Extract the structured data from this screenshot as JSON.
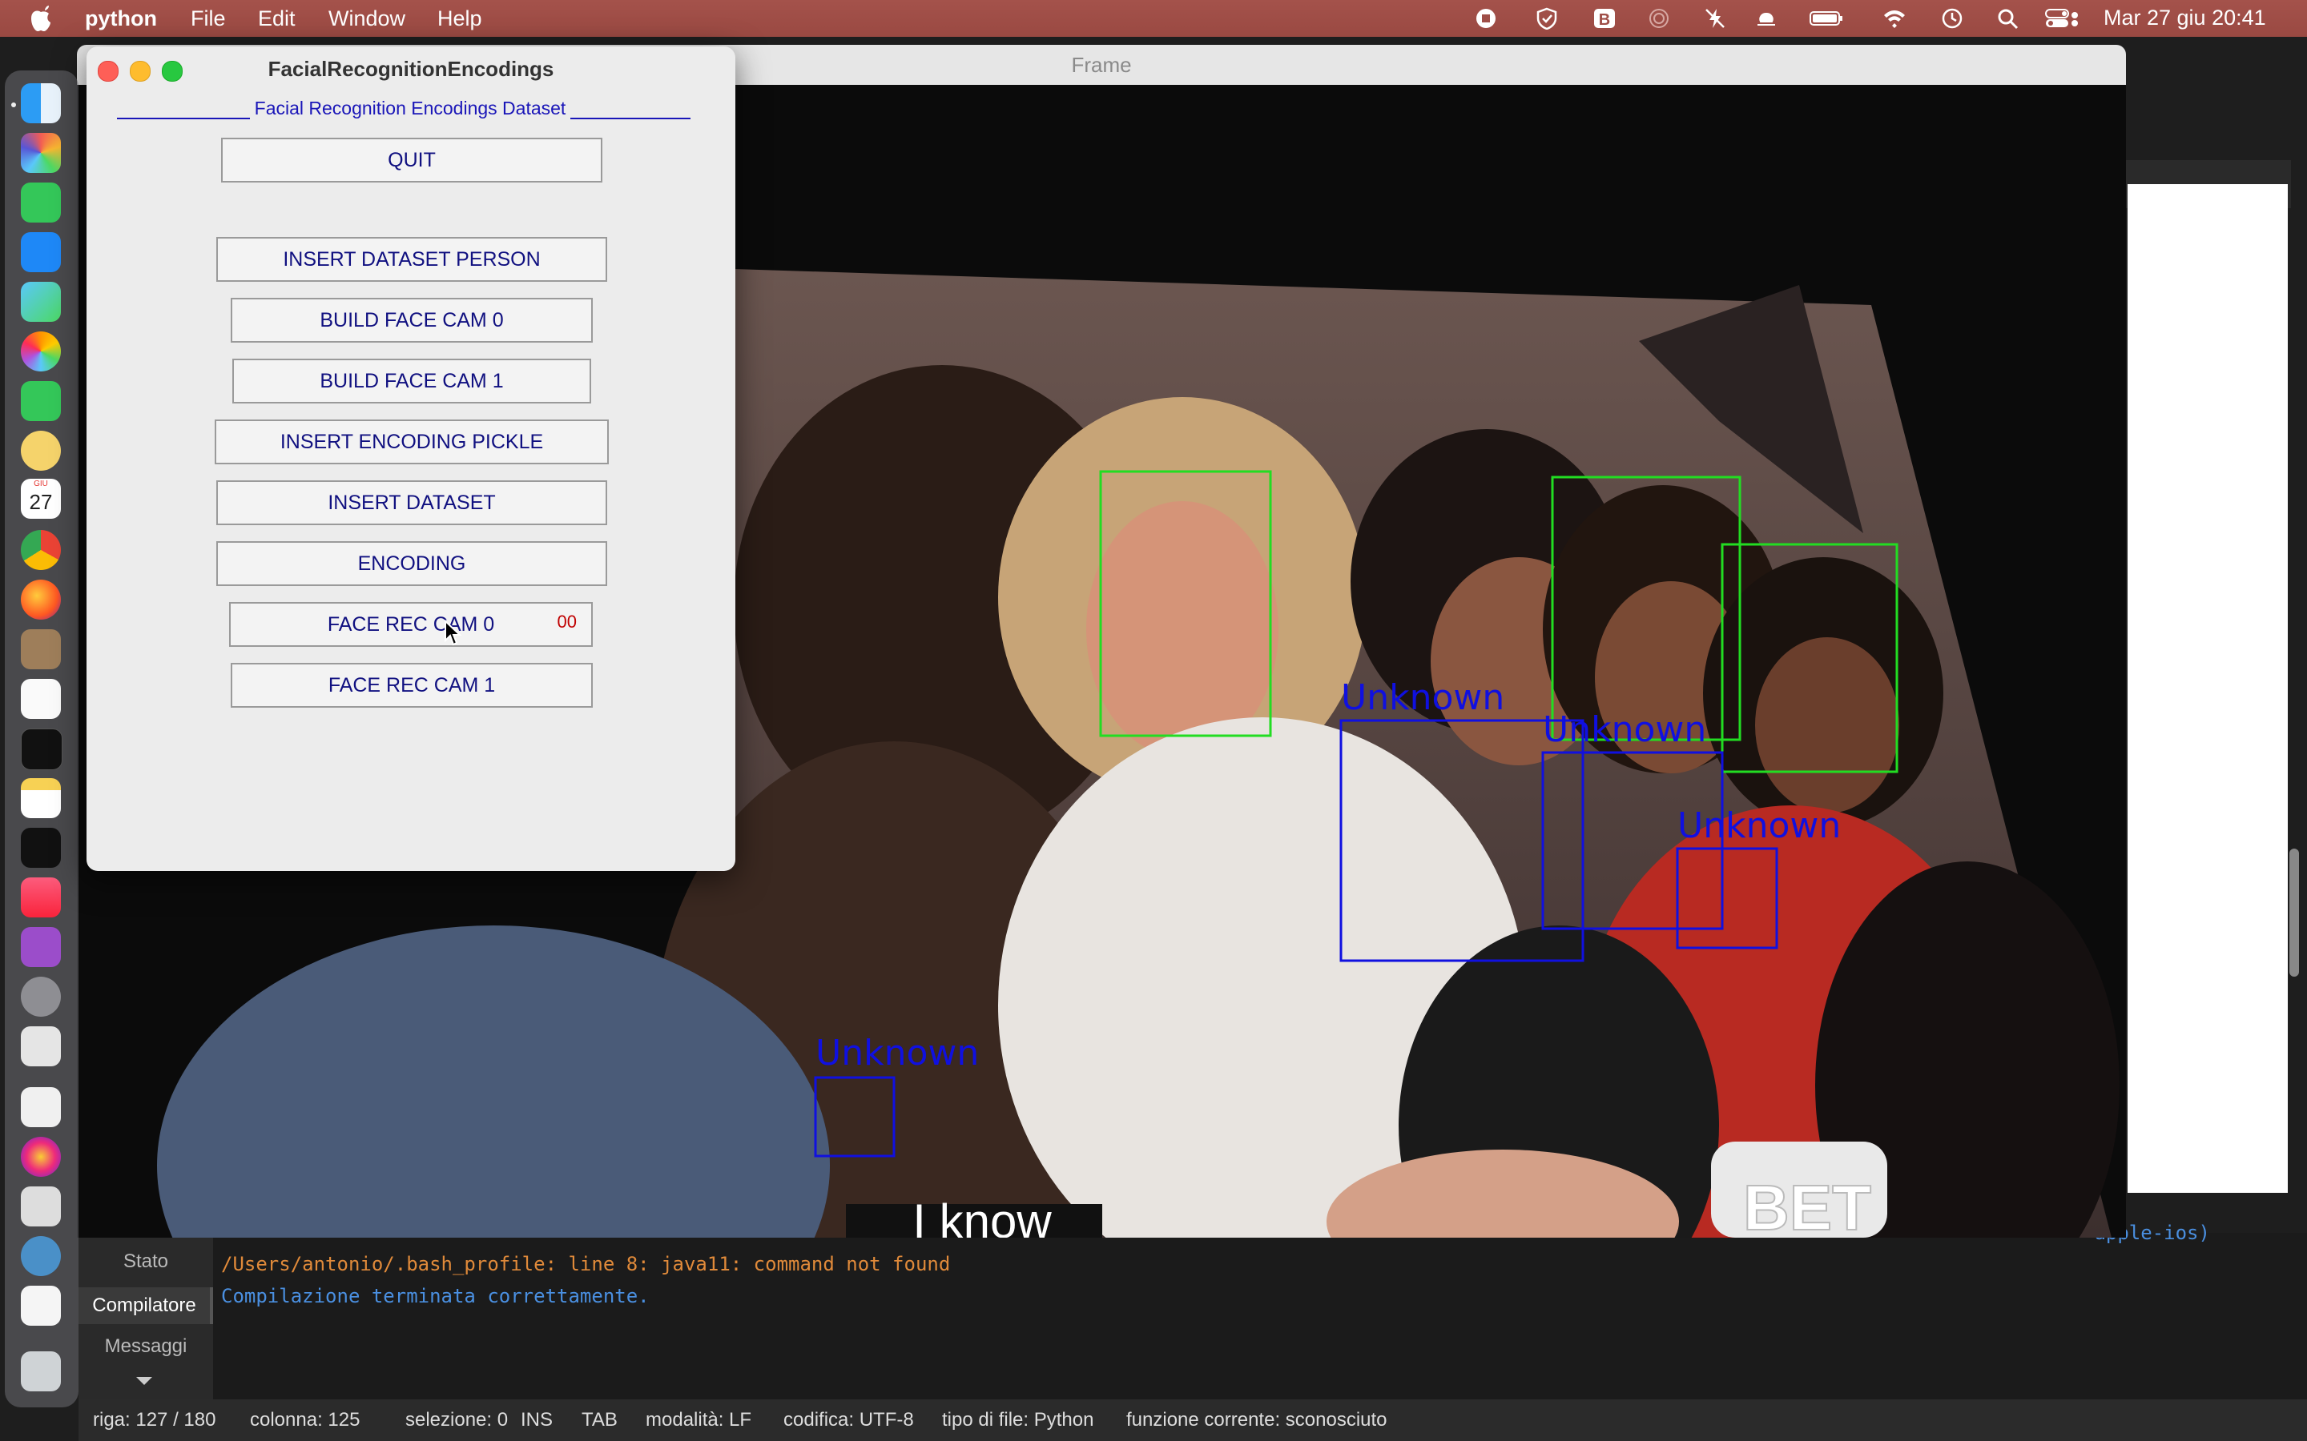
{
  "menubar": {
    "app_name": "python",
    "items": [
      "File",
      "Edit",
      "Window",
      "Help"
    ],
    "clock": "Mar 27 giu  20:41"
  },
  "dock": {
    "calendar_day": "27",
    "calendar_month": "GIU"
  },
  "frame_window": {
    "title": "Frame",
    "subtitle_overlay": "I know",
    "logo": "BET",
    "detections": [
      "Unknown",
      "Unknown",
      "Unknown",
      "Unknown"
    ]
  },
  "tk_window": {
    "title": "FacialRecognitionEncodings",
    "header": "Facial Recognition Encodings Dataset",
    "buttons": {
      "quit": "QUIT",
      "insert_dataset_person": "INSERT DATASET PERSON",
      "build_face_cam0": "BUILD FACE CAM 0",
      "build_face_cam1": "BUILD FACE CAM 1",
      "insert_encoding_pickle": "INSERT ENCODING PICKLE",
      "insert_dataset": "INSERT DATASET",
      "encoding": "ENCODING",
      "face_rec_cam0": "FACE REC CAM 0",
      "face_rec_cam1": "FACE REC CAM 1"
    },
    "counter": "00"
  },
  "editor": {
    "side_tabs": [
      "Stato",
      "Compilatore",
      "Messaggi"
    ],
    "console": {
      "truncated_line": "-apple-ios)",
      "error_line": "/Users/antonio/.bash_profile: line 8: java11: command not found",
      "success_line": "Compilazione terminata correttamente."
    },
    "statusbar": {
      "row": "riga: 127 / 180",
      "column": "colonna: 125",
      "selection": "selezione: 0",
      "ins": "INS",
      "tab": "TAB",
      "mode": "modalità: LF",
      "encoding": "codifica: UTF-8",
      "filetype": "tipo di file: Python",
      "function": "funzione corrente: sconosciuto"
    }
  },
  "colors": {
    "menubar": "#9f4e47",
    "tk_button_text": "#101080",
    "detection_known": "#22dd22",
    "detection_unknown": "#1010e0",
    "console_error": "#e08a3a",
    "console_success": "#4a8fe0"
  }
}
